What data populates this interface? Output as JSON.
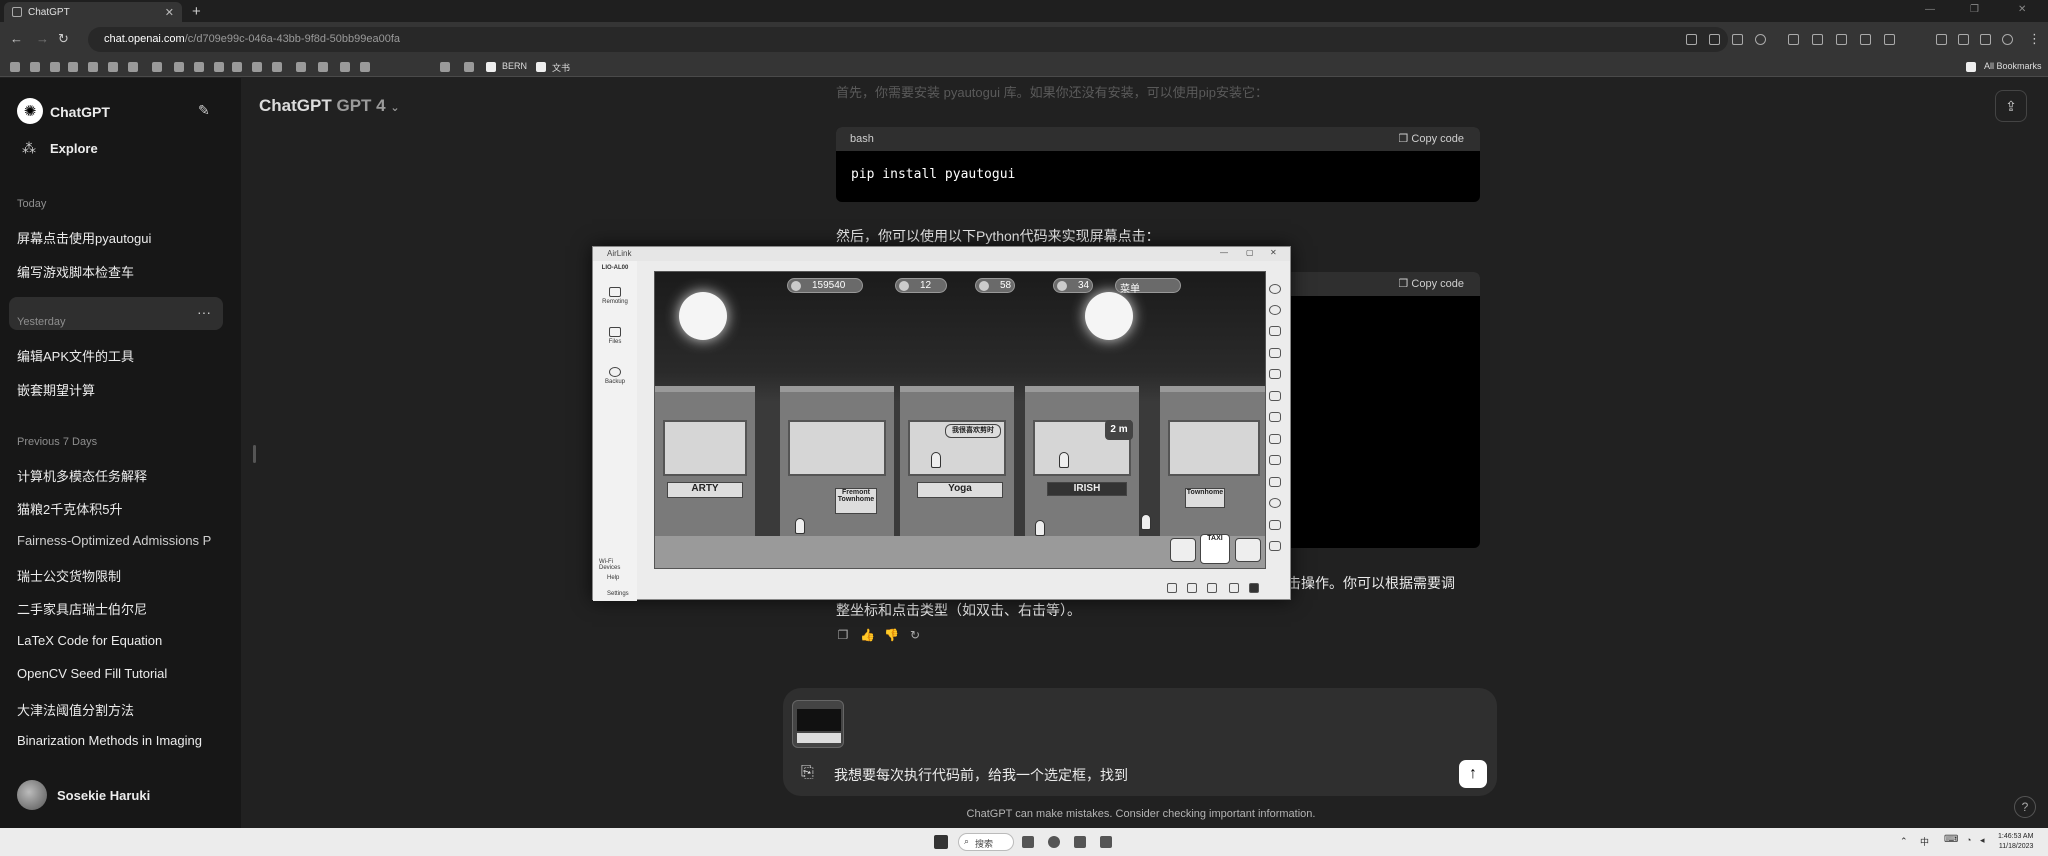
{
  "browser": {
    "tab_title": "ChatGPT",
    "url_host": "chat.openai.com",
    "url_path": "/c/d709e99c-046a-43bb-9f8d-50bb99ea00fa",
    "bookmarks": [
      "BERN",
      "文书"
    ],
    "all_bookmarks": "All Bookmarks"
  },
  "sidebar": {
    "app_name": "ChatGPT",
    "explore": "Explore",
    "sections": [
      {
        "label": "Today",
        "items": [
          "屏幕点击使用pyautogui",
          "编写游戏脚本检查车"
        ]
      },
      {
        "label": "Yesterday",
        "items": [
          "编辑APK文件的工具",
          "嵌套期望计算"
        ]
      },
      {
        "label": "Previous 7 Days",
        "items": [
          "计算机多模态任务解释",
          "猫粮2千克体积5升",
          "Fairness-Optimized Admissions P",
          "瑞士公交货物限制",
          "二手家具店瑞士伯尔尼",
          "LaTeX Code for Equation",
          "OpenCV Seed Fill Tutorial",
          "大津法阈值分割方法",
          "Binarization Methods in Imaging"
        ]
      }
    ],
    "user_name": "Sosekie Haruki"
  },
  "main": {
    "model_label": "GPT 4",
    "model_prefix": "ChatGPT",
    "faded_text": "首先，你需要安装 pyautogui 库。如果你还没有安装，可以使用pip安装它：",
    "code1": {
      "lang": "bash",
      "copy": "Copy code",
      "code": "pip install pyautogui"
    },
    "para1": "然后，你可以使用以下Python代码来实现屏幕点击：",
    "code2": {
      "copy": "Copy code"
    },
    "para2_tail": "击操作。你可以根据需要调",
    "para3": "整坐标和点击类型（如双击、右击等）。"
  },
  "airlink": {
    "title": "AirLink",
    "device": "LIO-AL00",
    "nav": [
      "Remoting",
      "Files",
      "Backup"
    ],
    "bottom": [
      "Wi-Fi Devices",
      "Help",
      "Settings"
    ],
    "game": {
      "coins": "159540",
      "gems": "12",
      "pop": "58",
      "bits": "34",
      "menu": "菜单",
      "speech": "我很喜欢剪时",
      "timer": "2 m",
      "signs": [
        "ARTY",
        "Fremont Townhome",
        "Yoga",
        "IRISH",
        "Townhome"
      ],
      "taxi": "TAXI"
    }
  },
  "composer": {
    "input_text": "我想要每次执行代码前，给我一个选定框，找到",
    "disclaimer": "ChatGPT can make mistakes. Consider checking important information."
  },
  "taskbar": {
    "search": "搜索",
    "time": "1:46:53 AM",
    "date": "11/18/2023"
  }
}
